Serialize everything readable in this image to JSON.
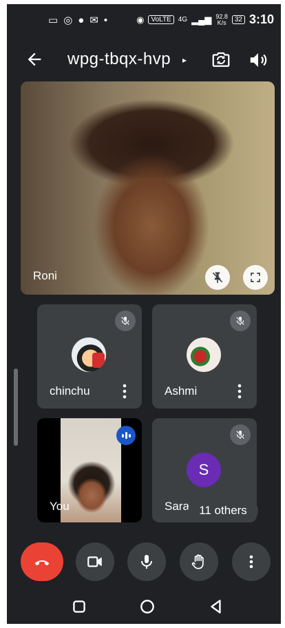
{
  "status_bar": {
    "time": "3:10",
    "network_speed_value": "92.8",
    "network_speed_unit": "K/s",
    "volte": "VoLTE",
    "network_type": "4G",
    "battery": "32"
  },
  "header": {
    "meeting_code": "wpg-tbqx-hvp",
    "title_arrow": "▸"
  },
  "main_tile": {
    "name": "Roni"
  },
  "participants": [
    {
      "name": "chinchu",
      "muted": true
    },
    {
      "name": "Ashmi",
      "muted": true
    },
    {
      "name": "You",
      "speaking": true
    },
    {
      "name": "Sara",
      "initial": "S",
      "avatar_color": "#6a2bb5",
      "muted": true
    }
  ],
  "others_label": "11 others",
  "colors": {
    "background": "#202124",
    "tile": "#3c4043",
    "end_call": "#ea4335",
    "speaking": "#1a56c8"
  },
  "icons": {
    "back": "arrow-left",
    "switch_camera": "camera-switch",
    "speaker": "volume",
    "unpin": "pin-off",
    "fullscreen": "fullscreen",
    "mic_off": "mic-off",
    "more": "more-vert",
    "end_call": "phone-hangup",
    "camera": "videocam",
    "mic": "mic",
    "raise_hand": "hand",
    "recents": "square",
    "home": "circle",
    "back_nav": "triangle"
  }
}
